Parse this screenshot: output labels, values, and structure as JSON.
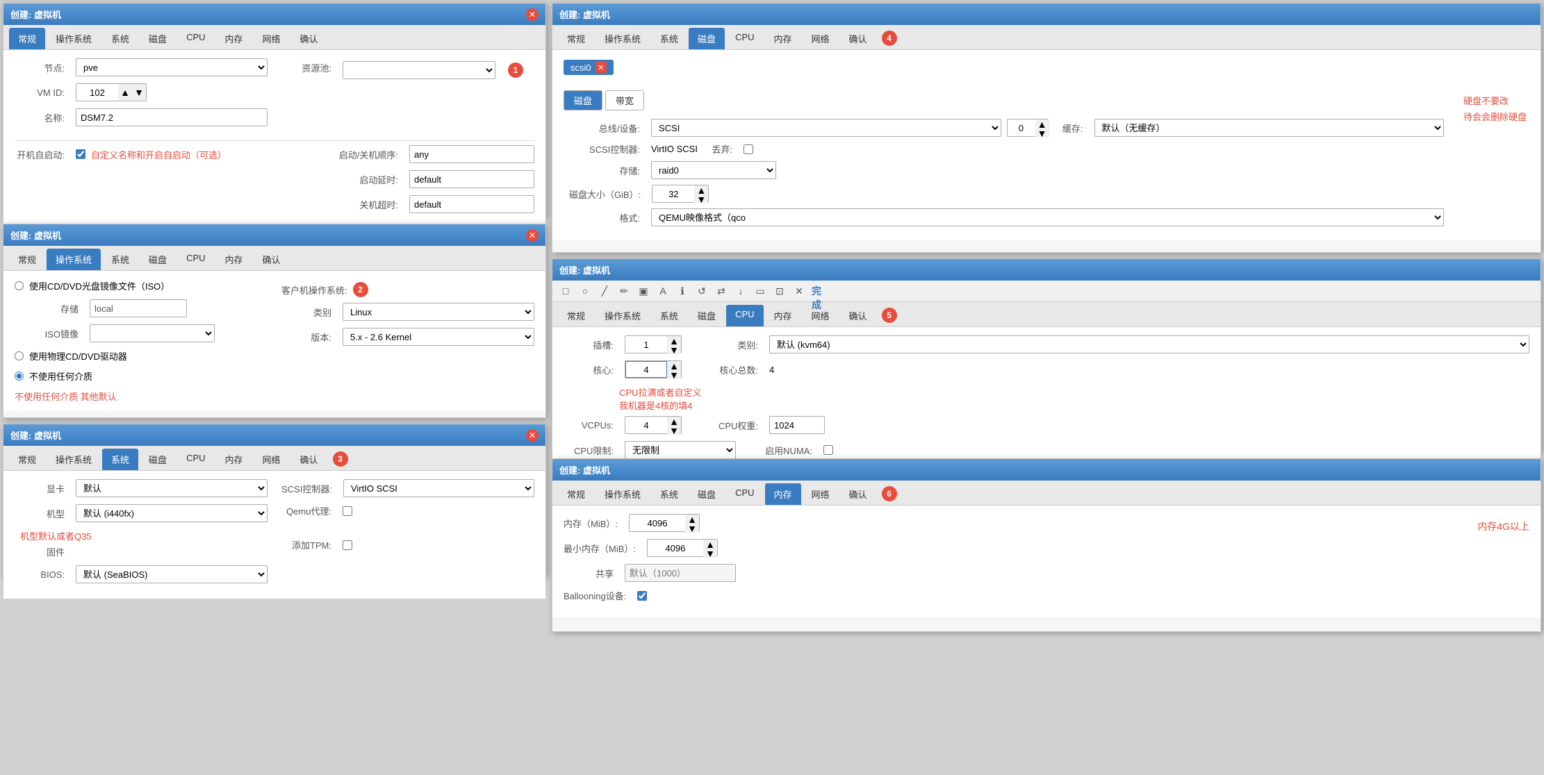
{
  "panels": {
    "panel1": {
      "title": "创建: 虚拟机",
      "tabs": [
        "常规",
        "操作系统",
        "系统",
        "磁盘",
        "CPU",
        "内存",
        "网络",
        "确认"
      ],
      "active_tab": "常规",
      "badge": null,
      "fields": {
        "node_label": "节点:",
        "node_value": "pve",
        "resource_pool_label": "资源池:",
        "vmid_label": "VM ID:",
        "vmid_value": "102",
        "name_label": "名称:",
        "name_value": "DSM7.2",
        "autostart_label": "开机自启动:",
        "autostart_checked": true,
        "annotation": "自定义名称和开启自启动（可选）",
        "startup_order_label": "启动/关机顺序:",
        "startup_order_value": "any",
        "boot_delay_label": "启动延时:",
        "boot_delay_value": "default",
        "shutdown_timeout_label": "关机超时:",
        "shutdown_timeout_value": "default"
      }
    },
    "panel2": {
      "title": "创建: 虚拟机",
      "tabs": [
        "常规",
        "操作系统",
        "系统",
        "磁盘",
        "CPU",
        "内存",
        "确认"
      ],
      "active_tab": "操作系统",
      "badge": null,
      "fields": {
        "iso_radio_label": "使用CD/DVD光盘镜像文件（ISO）",
        "storage_label": "存储",
        "storage_value": "local",
        "iso_label": "ISO镜像",
        "physical_cd_label": "使用物理CD/DVD驱动器",
        "no_media_label": "不使用任何介质",
        "no_media_checked": true,
        "annotation": "不使用任何介质 其他默认",
        "guest_os_label": "客户机操作系统:",
        "category_label": "类别",
        "category_value": "Linux",
        "version_label": "版本:",
        "version_value": "5.x - 2.6 Kernel",
        "badge": "2"
      }
    },
    "panel3": {
      "title": "创建: 虚拟机",
      "tabs": [
        "常规",
        "操作系统",
        "系统",
        "磁盘",
        "CPU",
        "内存",
        "网络",
        "确认"
      ],
      "active_tab": "系统",
      "badge": "3",
      "fields": {
        "graphics_label": "显卡",
        "graphics_value": "默认",
        "machine_label": "机型",
        "machine_value": "默认 (i440fx)",
        "firmware_label": "固件",
        "bios_label": "BIOS:",
        "bios_value": "默认 (SeaBIOS)",
        "scsi_ctrl_label": "SCSI控制器:",
        "scsi_ctrl_value": "VirtIO SCSI",
        "qemu_agent_label": "Qemu代理:",
        "qemu_agent_checked": false,
        "add_tpm_label": "添加TPM:",
        "add_tpm_checked": false,
        "annotation": "机型默认或者Q35"
      }
    }
  },
  "right_panels": {
    "panel_disk": {
      "title": "创建: 虚拟机",
      "tabs": [
        "常规",
        "操作系统",
        "系统",
        "磁盘",
        "CPU",
        "内存",
        "网络",
        "确认"
      ],
      "active_tab": "磁盘",
      "badge": "4",
      "scsi_tag": "scsi0",
      "sub_tabs": [
        "磁盘",
        "带宽"
      ],
      "active_sub_tab": "磁盘",
      "fields": {
        "bus_device_label": "总线/设备:",
        "bus_value": "SCSI",
        "device_value": "0",
        "cache_label": "缓存:",
        "cache_value": "默认（无缓存）",
        "scsi_ctrl_label": "SCSI控制器:",
        "scsi_ctrl_value": "VirtIO SCSI",
        "discard_label": "丢弃:",
        "storage_label": "存储:",
        "storage_value": "raid0",
        "disk_size_label": "磁盘大小（GiB）:",
        "disk_size_value": "32",
        "format_label": "格式:",
        "format_value": "QEMU映像格式（qco",
        "annotation_line1": "硬盘不要改",
        "annotation_line2": "待会会删除硬盘"
      }
    },
    "panel_cpu": {
      "title": "创建: 虚拟机",
      "tabs": [
        "常规",
        "操作系统",
        "系统",
        "磁盘",
        "CPU",
        "内存",
        "网络",
        "确认"
      ],
      "active_tab": "CPU",
      "badge": "5",
      "toolbar_icons": [
        "□",
        "○",
        "╱",
        "✏",
        "▣",
        "A",
        "ℹ",
        "↺",
        "⇄",
        "↓",
        "▭",
        "⊡",
        "✕",
        "✓完成"
      ],
      "fields": {
        "slot_label": "插槽:",
        "slot_value": "1",
        "type_label": "类别:",
        "type_value": "默认 (kvm64)",
        "core_label": "核心:",
        "core_value": "4",
        "total_core_label": "核心总数:",
        "total_core_value": "4",
        "annotation_line1": "CPU拉满或者自定义",
        "annotation_line2": "我机器是4核的填4",
        "vcpus_label": "VCPUs:",
        "vcpus_value": "4",
        "cpu_weight_label": "CPU权重:",
        "cpu_weight_value": "1024",
        "cpu_limit_label": "CPU限制:",
        "cpu_limit_value": "无限制",
        "enable_numa_label": "启用NUMA:",
        "enable_numa_checked": false
      }
    },
    "panel_memory": {
      "title": "创建: 虚拟机",
      "tabs": [
        "常规",
        "操作系统",
        "系统",
        "磁盘",
        "CPU",
        "内存",
        "网络",
        "确认"
      ],
      "active_tab": "内存",
      "badge": "6",
      "fields": {
        "memory_label": "内存（MiB）:",
        "memory_value": "4096",
        "min_memory_label": "最小内存（MiB）:",
        "min_memory_value": "4096",
        "shared_label": "共享",
        "shared_placeholder": "默认（1000）",
        "ballooning_label": "Ballooning设备:",
        "ballooning_checked": true,
        "annotation": "内存4G以上"
      }
    }
  },
  "icons": {
    "close": "✕",
    "up_arrow": "▲",
    "down_arrow": "▼",
    "delete": "✕"
  }
}
